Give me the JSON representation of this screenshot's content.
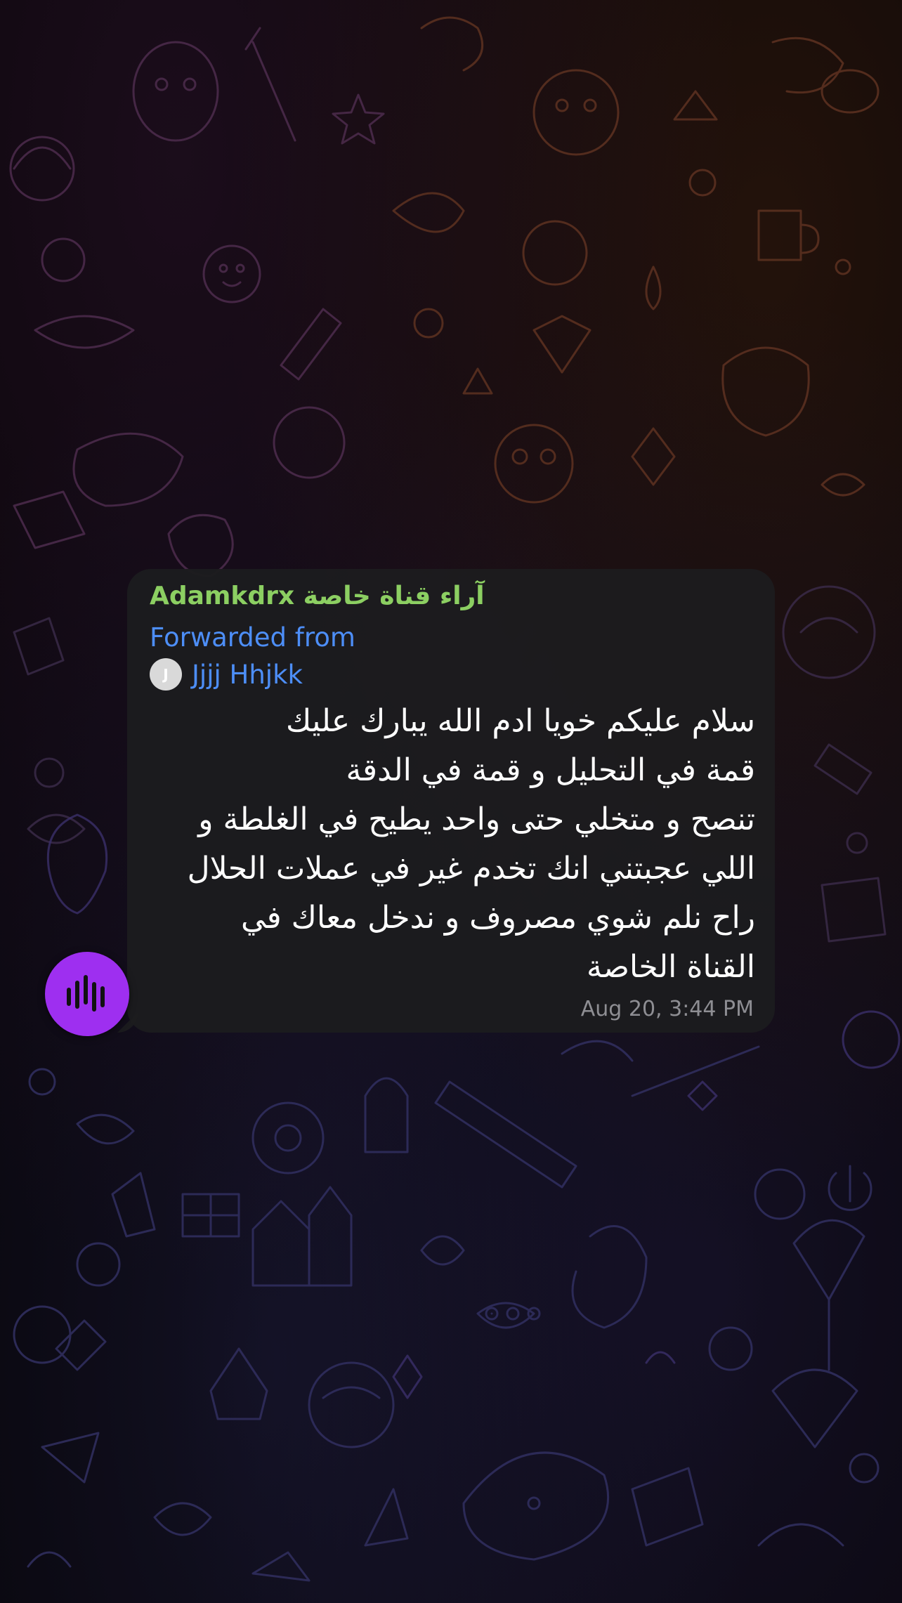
{
  "message": {
    "sender": "Adamkdrx آراء قناة خاصة",
    "forwarded_label": "Forwarded from",
    "forwarded_avatar_initial": "J",
    "forwarded_name": "Jjjj Hhjkk",
    "text_lines": [
      "سلام عليكم خويا ادم الله يبارك عليك",
      "قمة في التحليل و قمة في الدقة",
      "تنصح و متخلي حتى واحد يطيح في الغلطة و",
      "اللي عجبتني انك تخدم غير في عملات الحلال",
      "راح نلم شوي مصروف و ندخل معاك في",
      "القناة الخاصة"
    ],
    "timestamp": "Aug 20, 3:44 PM"
  },
  "voice_button": {
    "icon": "waveform-icon",
    "color": "#9e2ff0"
  },
  "colors": {
    "bubble": "#1c1c1e",
    "sender": "#8ccf62",
    "forwarded": "#4d8ef7",
    "timestamp": "#8e8e93"
  }
}
